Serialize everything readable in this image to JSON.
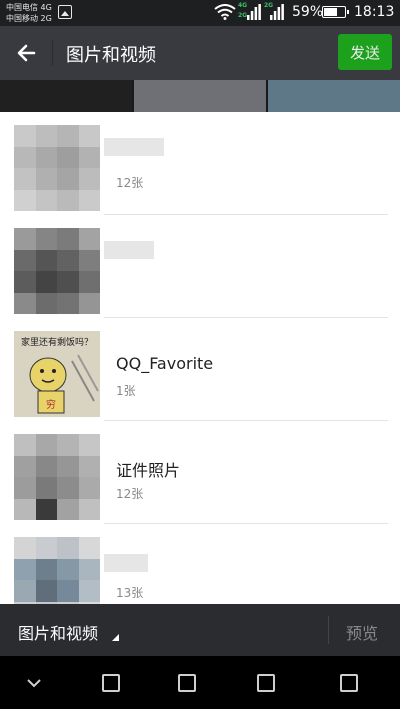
{
  "status_bar": {
    "carrier_1": "中国电信 4G",
    "carrier_2": "中国移动 2G",
    "network_tag_1": "4G",
    "network_tag_2": "2G",
    "network_tag_3": "2G",
    "battery_percent": "59%",
    "battery_level": 0.59,
    "time": "18:13",
    "icons": [
      "sim-card-icon",
      "wifi-icon",
      "signal-icon",
      "signal-icon",
      "battery-icon"
    ]
  },
  "header": {
    "title": "图片和视频",
    "send_label": "发送",
    "send_color": "#1aad19",
    "back_icon": "arrow-left-icon"
  },
  "albums": [
    {
      "name": "",
      "count": "12张",
      "thumb": "blurred"
    },
    {
      "name": "",
      "count": "",
      "thumb": "blurred"
    },
    {
      "name": "QQ_Favorite",
      "count": "1张",
      "thumb_caption": "家里还有剩饭吗？",
      "thumb_char": "穷"
    },
    {
      "name": "证件照片",
      "count": "12张",
      "thumb": "blurred"
    },
    {
      "name": "",
      "count": "13张",
      "thumb": "blurred"
    }
  ],
  "footer": {
    "folder_label": "图片和视频",
    "preview_label": "预览"
  },
  "nav": {
    "icons": [
      "chevron-down-icon",
      "square-icon",
      "square-icon",
      "square-icon",
      "square-icon"
    ]
  }
}
